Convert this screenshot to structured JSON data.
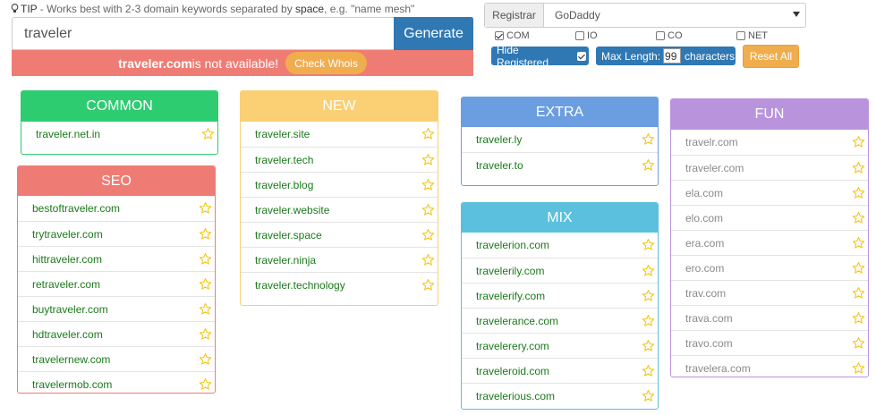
{
  "tip": {
    "prefix": "TIP",
    "text_a": " - Works best with 2-3 domain keywords separated by ",
    "text_b": "space",
    "text_c": ", e.g. \"name mesh\""
  },
  "search": {
    "value": "traveler",
    "generate_label": "Generate"
  },
  "availability": {
    "domain": "traveler.com",
    "message": " is not available!",
    "whois_label": "Check Whois"
  },
  "registrar": {
    "label": "Registrar",
    "selected": "GoDaddy"
  },
  "tlds": [
    {
      "label": "COM",
      "checked": true
    },
    {
      "label": "IO",
      "checked": false
    },
    {
      "label": "CO",
      "checked": false
    },
    {
      "label": "NET",
      "checked": false
    }
  ],
  "options": {
    "hide_registered_label": "Hide Registered",
    "hide_registered_checked": true,
    "max_length_label": "Max Length:",
    "max_length_value": "99",
    "max_length_suffix": "characters",
    "reset_label": "Reset All"
  },
  "colors": {
    "common": "#2ecc71",
    "seo": "#ef7c74",
    "new": "#fbcf73",
    "extra": "#6a9ee0",
    "mix": "#5bc0de",
    "fun": "#b994dd",
    "star": "#f5c518",
    "primary": "#2f78b4",
    "warning": "#f0ad4e"
  },
  "panels": {
    "common": {
      "title": "COMMON",
      "items": [
        "traveler.net.in"
      ]
    },
    "seo": {
      "title": "SEO",
      "items": [
        "bestoftraveler.com",
        "trytraveler.com",
        "hittraveler.com",
        "retraveler.com",
        "buytraveler.com",
        "hdtraveler.com",
        "travelernew.com",
        "travelermob.com"
      ]
    },
    "new": {
      "title": "NEW",
      "items": [
        "traveler.site",
        "traveler.tech",
        "traveler.blog",
        "traveler.website",
        "traveler.space",
        "traveler.ninja",
        "traveler.technology"
      ]
    },
    "extra": {
      "title": "EXTRA",
      "items": [
        "traveler.ly",
        "traveler.to"
      ]
    },
    "mix": {
      "title": "MIX",
      "items": [
        "travelerion.com",
        "travelerily.com",
        "travelerify.com",
        "travelerance.com",
        "travelerery.com",
        "traveleroid.com",
        "travelerious.com"
      ]
    },
    "fun": {
      "title": "FUN",
      "items": [
        "travelr.com",
        "traveler.com",
        "ela.com",
        "elo.com",
        "era.com",
        "ero.com",
        "trav.com",
        "trava.com",
        "travo.com",
        "travelera.com"
      ]
    }
  }
}
